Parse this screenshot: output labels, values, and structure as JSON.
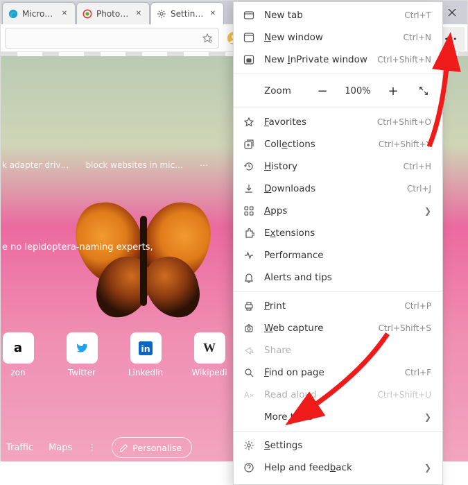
{
  "tabs": [
    {
      "label": "Microsoft E",
      "icon": "edge"
    },
    {
      "label": "PhotoScap",
      "icon": "photoscape"
    },
    {
      "label": "Settings",
      "icon": "gear"
    }
  ],
  "toolbar": {
    "profile_icon": "profile"
  },
  "content": {
    "quicklinks": [
      "k adapter driv…",
      "block websites in mic…",
      "⋯"
    ],
    "caption": "e no lepidoptera-naming experts,",
    "tiles": [
      {
        "label": "zon",
        "icon": "amazon",
        "color": "#000"
      },
      {
        "label": "Twitter",
        "icon": "twitter",
        "color": "#1da1f2"
      },
      {
        "label": "LinkedIn",
        "icon": "linkedin",
        "color": "#0a66c2"
      },
      {
        "label": "Wikipedi",
        "icon": "wiki",
        "color": "#222"
      }
    ],
    "bottombar": {
      "traffic": "Traffic",
      "maps": "Maps",
      "personalise": "Personalise"
    }
  },
  "menu": {
    "new_tab": {
      "label": "New tab",
      "acc": "Ctrl+T",
      "u": ""
    },
    "new_window": {
      "label": "New window",
      "acc": "Ctrl+N",
      "u": "N"
    },
    "inprivate": {
      "label": "New InPrivate window",
      "acc": "Ctrl+Shift+N",
      "u": "I"
    },
    "zoom": {
      "label": "Zoom",
      "value": "100%"
    },
    "favorites": {
      "label": "Favorites",
      "acc": "Ctrl+Shift+O",
      "u": "F"
    },
    "collections": {
      "label": "Collections",
      "acc": "Ctrl+Shift+Y",
      "u": "e"
    },
    "history": {
      "label": "History",
      "acc": "Ctrl+H",
      "u": "H"
    },
    "downloads": {
      "label": "Downloads",
      "acc": "Ctrl+J",
      "u": "D"
    },
    "apps": {
      "label": "Apps",
      "u": "A"
    },
    "extensions": {
      "label": "Extensions",
      "u": "x"
    },
    "performance": {
      "label": "Performance"
    },
    "alerts": {
      "label": "Alerts and tips"
    },
    "print": {
      "label": "Print",
      "acc": "Ctrl+P",
      "u": "P"
    },
    "webcapture": {
      "label": "Web capture",
      "acc": "Ctrl+Shift+S",
      "u": "W"
    },
    "share": {
      "label": "Share"
    },
    "find": {
      "label": "Find on page",
      "acc": "Ctrl+F",
      "u": "F"
    },
    "readaloud": {
      "label": "Read aloud",
      "acc": "Ctrl+Shift+U",
      "u": ""
    },
    "moretools": {
      "label": "More tools"
    },
    "settings": {
      "label": "Settings",
      "u": "S"
    },
    "help": {
      "label": "Help and feedback",
      "u": "b"
    }
  }
}
